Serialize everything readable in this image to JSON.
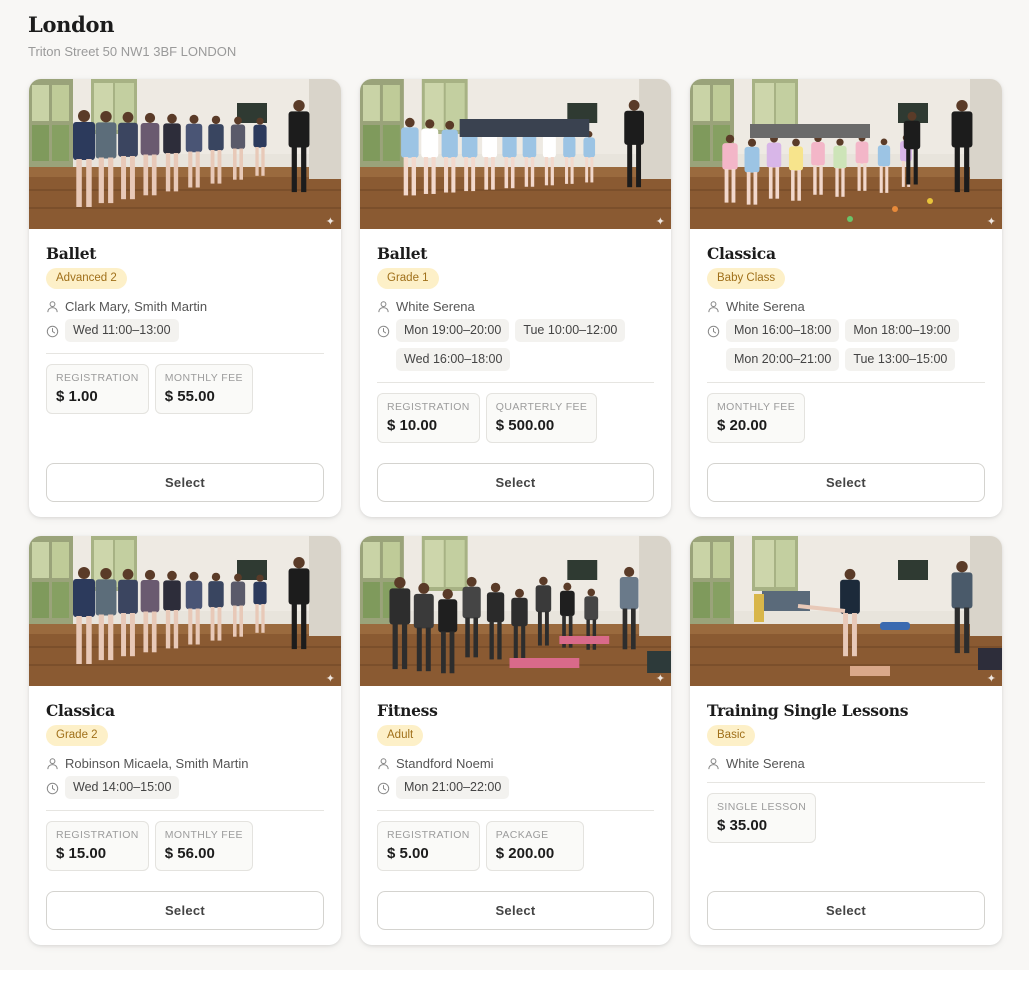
{
  "location": {
    "title": "London",
    "address": "Triton Street 50 NW1 3BF LONDON"
  },
  "select_label": "Select",
  "colors": {
    "level_badge_bg": "#fdf0c8",
    "level_badge_text": "#a0701a",
    "card_bg": "#ffffff",
    "page_bg": "#f8f7f5"
  },
  "icons": {
    "teacher": "person-icon",
    "schedule": "clock-icon"
  },
  "courses": [
    {
      "title": "Ballet",
      "level": "Advanced 2",
      "teachers": "Clark Mary, Smith Martin",
      "times": [
        "Wed 11:00–13:00"
      ],
      "fees": [
        {
          "label": "REGISTRATION",
          "amount": "$ 1.00"
        },
        {
          "label": "MONTHLY FEE",
          "amount": "$ 55.00"
        }
      ],
      "photo": "ballet-class-photo"
    },
    {
      "title": "Ballet",
      "level": "Grade 1",
      "teachers": "White Serena",
      "times": [
        "Mon 19:00–20:00",
        "Tue 10:00–12:00",
        "Wed 16:00–18:00"
      ],
      "fees": [
        {
          "label": "REGISTRATION",
          "amount": "$ 10.00"
        },
        {
          "label": "QUARTERLY FEE",
          "amount": "$ 500.00"
        }
      ],
      "photo": "ballet-children-photo"
    },
    {
      "title": "Classica",
      "level": "Baby Class",
      "teachers": "White Serena",
      "times": [
        "Mon 16:00–18:00",
        "Mon 18:00–19:00",
        "Mon 20:00–21:00",
        "Tue 13:00–15:00"
      ],
      "fees": [
        {
          "label": "MONTHLY FEE",
          "amount": "$ 20.00"
        }
      ],
      "photo": "baby-class-photo"
    },
    {
      "title": "Classica",
      "level": "Grade 2",
      "teachers": "Robinson Micaela, Smith Martin",
      "times": [
        "Wed 14:00–15:00"
      ],
      "fees": [
        {
          "label": "REGISTRATION",
          "amount": "$ 15.00"
        },
        {
          "label": "MONTHLY FEE",
          "amount": "$ 56.00"
        }
      ],
      "photo": "ballet-class-photo"
    },
    {
      "title": "Fitness",
      "level": "Adult",
      "teachers": "Standford Noemi",
      "times": [
        "Mon 21:00–22:00"
      ],
      "fees": [
        {
          "label": "REGISTRATION",
          "amount": "$ 5.00"
        },
        {
          "label": "PACKAGE",
          "amount": "$ 200.00"
        }
      ],
      "photo": "fitness-class-photo"
    },
    {
      "title": "Training Single Lessons",
      "level": "Basic",
      "teachers": "White Serena",
      "times": [],
      "fees": [
        {
          "label": "SINGLE LESSON",
          "amount": "$ 35.00"
        }
      ],
      "photo": "single-lesson-photo"
    }
  ]
}
